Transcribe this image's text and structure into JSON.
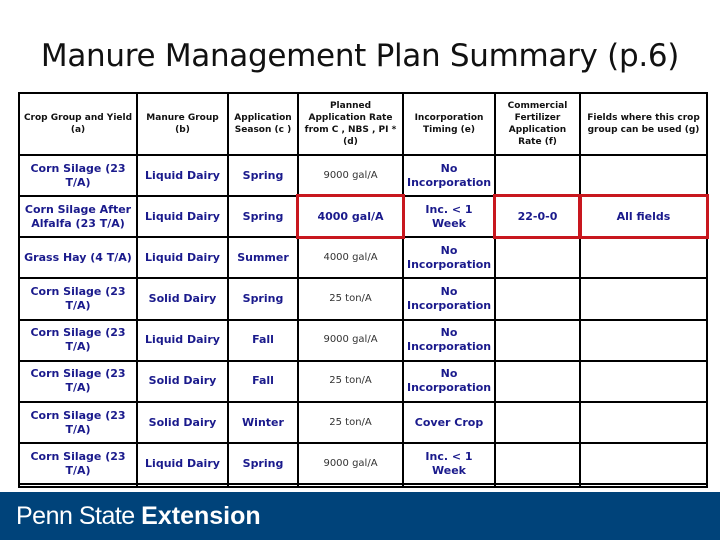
{
  "title": "Manure Management Plan Summary (p.6)",
  "table": {
    "headers": [
      "Crop Group and Yield (a)",
      "Manure Group (b)",
      "Application Season (c )",
      "Planned Application Rate from C , NBS , PI * (d)",
      "Incorporation Timing (e)",
      "Commercial Fertilizer Application Rate (f)",
      "Fields where this crop group can be used (g)"
    ],
    "rows": [
      {
        "crop": "Corn Silage (23 T/A)",
        "manure": "Liquid Dairy",
        "season": "Spring",
        "rate": "9000 gal/A",
        "incorporation": "No Incorporation",
        "fertilizer": "",
        "fields": ""
      },
      {
        "crop": "Corn Silage After Alfalfa (23 T/A)",
        "manure": "Liquid Dairy",
        "season": "Spring",
        "rate": "4000 gal/A",
        "incorporation": "Inc. < 1 Week",
        "fertilizer": "22-0-0",
        "fields": "All fields"
      },
      {
        "crop": "Grass Hay (4 T/A)",
        "manure": "Liquid Dairy",
        "season": "Summer",
        "rate": "4000 gal/A",
        "incorporation": "No Incorporation",
        "fertilizer": "",
        "fields": ""
      },
      {
        "crop": "Corn Silage (23 T/A)",
        "manure": "Solid Dairy",
        "season": "Spring",
        "rate": "25 ton/A",
        "incorporation": "No Incorporation",
        "fertilizer": "",
        "fields": ""
      },
      {
        "crop": "Corn Silage (23 T/A)",
        "manure": "Liquid Dairy",
        "season": "Fall",
        "rate": "9000 gal/A",
        "incorporation": "No Incorporation",
        "fertilizer": "",
        "fields": ""
      },
      {
        "crop": "Corn Silage (23 T/A)",
        "manure": "Solid Dairy",
        "season": "Fall",
        "rate": "25 ton/A",
        "incorporation": "No Incorporation",
        "fertilizer": "",
        "fields": ""
      },
      {
        "crop": "Corn Silage (23 T/A)",
        "manure": "Solid Dairy",
        "season": "Winter",
        "rate": "25 ton/A",
        "incorporation": "Cover Crop",
        "fertilizer": "",
        "fields": ""
      },
      {
        "crop": "Corn Silage (23 T/A)",
        "manure": "Liquid Dairy",
        "season": "Spring",
        "rate": "9000 gal/A",
        "incorporation": "Inc. < 1 Week",
        "fertilizer": "",
        "fields": ""
      },
      {
        "crop": "",
        "manure": "",
        "season": "",
        "rate": "",
        "incorporation": "",
        "fertilizer": "",
        "fields": ""
      }
    ],
    "highlighted_cells": [
      "rows.1.rate",
      "rows.1.fertilizer",
      "rows.1.fields"
    ],
    "highlight_color": "#c8171e"
  },
  "footer": {
    "brand_light": "Penn State",
    "brand_bold": "Extension",
    "background": "#00437a"
  }
}
